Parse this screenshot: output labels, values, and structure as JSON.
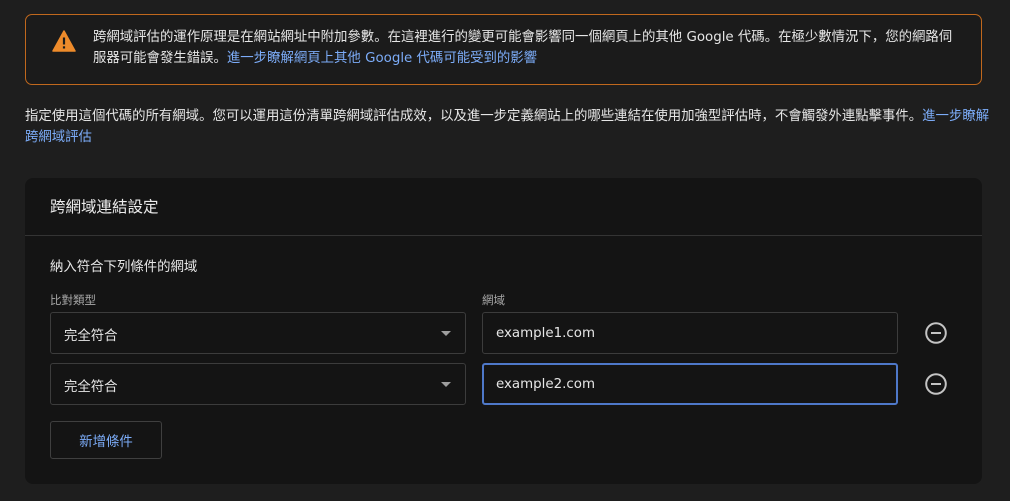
{
  "warning": {
    "icon": "warning-icon",
    "accent_color": "#c0681d",
    "text": "跨網域評估的運作原理是在網站網址中附加參數。在這裡進行的變更可能會影響同一個網頁上的其他 Google 代碼。在極少數情況下，您的網路伺服器可能會發生錯誤。",
    "link": "進一步瞭解網頁上其他 Google 代碼可能受到的影響"
  },
  "description": {
    "text": "指定使用這個代碼的所有網域。您可以運用這份清單跨網域評估成效，以及進一步定義網站上的哪些連結在使用加強型評估時，不會觸發外連點擊事件。",
    "link": "進一步瞭解跨網域評估"
  },
  "card": {
    "title": "跨網域連結設定",
    "section_title": "納入符合下列條件的網域",
    "match_type_label": "比對類型",
    "domain_label": "網域",
    "rows": [
      {
        "match_type": "完全符合",
        "domain": "example1.com"
      },
      {
        "match_type": "完全符合",
        "domain": "example2.com"
      }
    ],
    "add_button_label": "新增條件",
    "remove_icon": "remove-circle-icon",
    "dropdown_icon": "dropdown-arrow-icon"
  },
  "colors": {
    "link": "#7cacf8",
    "focus_border": "#4e78c9"
  }
}
